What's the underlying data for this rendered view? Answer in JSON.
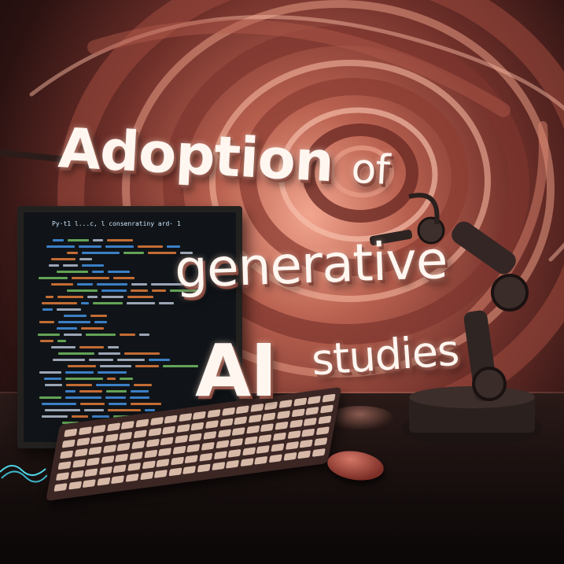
{
  "headline": {
    "line1_main": "Adoption",
    "line1_tail": "of",
    "line2": "generative",
    "line3_ai": "AI",
    "line3_rest": "studies"
  },
  "monitor": {
    "title_text": "Py·t1 l...c, l consenratiny  ard· 1"
  },
  "colors": {
    "background_warm": "#b8604f",
    "headline_text": "#fff6f0",
    "code_blue": "#4aa3ff",
    "code_orange": "#ff8a3d",
    "code_green": "#7fd36b"
  },
  "icons": [
    "monitor-icon",
    "keyboard-icon",
    "mouse-icon",
    "robot-arm-icon",
    "cable-icon"
  ]
}
